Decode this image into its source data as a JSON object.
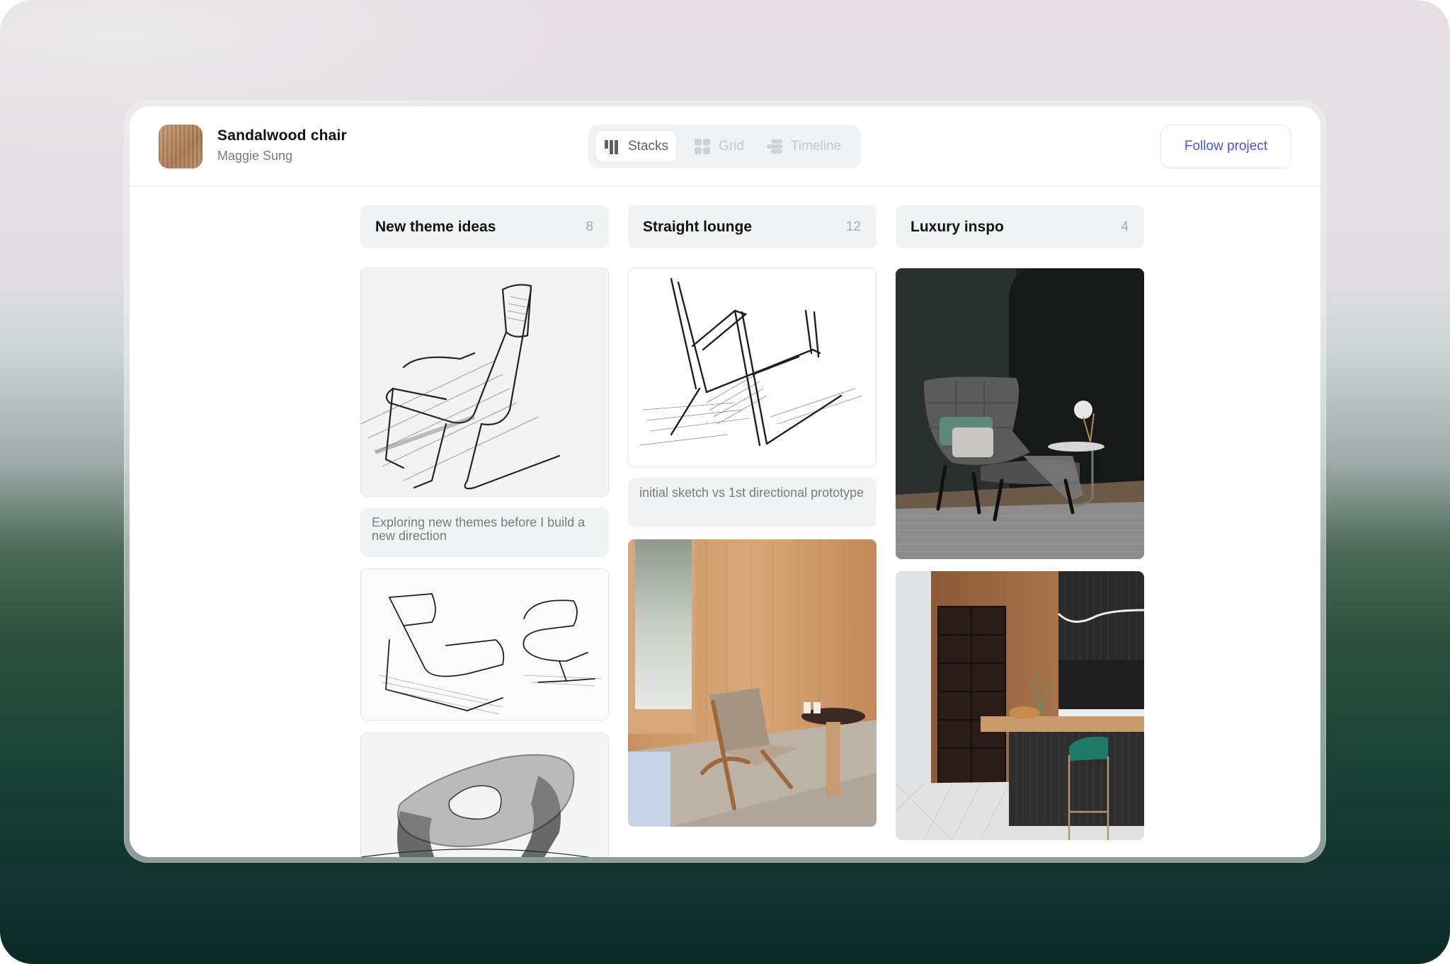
{
  "project": {
    "title": "Sandalwood chair",
    "owner": "Maggie Sung",
    "thumbnail": "wood-texture-thumbnail"
  },
  "view_toggle": {
    "options": [
      {
        "label": "Stacks",
        "icon": "stacks-icon",
        "active": true
      },
      {
        "label": "Grid",
        "icon": "grid-icon",
        "active": false
      },
      {
        "label": "Timeline",
        "icon": "timeline-icon",
        "active": false
      }
    ]
  },
  "actions": {
    "follow_label": "Follow project",
    "accent": "#4a55e6"
  },
  "columns": [
    {
      "title": "New theme ideas",
      "count": "8",
      "items": [
        {
          "type": "image",
          "description": "pencil sketch of tall reclining lounge chair with headrest"
        },
        {
          "type": "caption",
          "text": "Exploring new themes before I build a new direction"
        },
        {
          "type": "image",
          "description": "pencil sketch of cantilever lounger and swivel lounge chair"
        },
        {
          "type": "image",
          "description": "pencil sketch of sculptural bowl chair"
        }
      ]
    },
    {
      "title": "Straight lounge",
      "count": "12",
      "items": [
        {
          "type": "image",
          "description": "rough ink sketch of angular wooden lounge chair"
        },
        {
          "type": "caption",
          "text": "initial sketch vs 1st directional prototype"
        },
        {
          "type": "image",
          "description": "photo of woven folding chair against wood-paneled wall"
        }
      ]
    },
    {
      "title": "Luxury inspo",
      "count": "4",
      "items": [
        {
          "type": "image",
          "description": "photo of grey quilted wingback chair with ottoman in dark room"
        },
        {
          "type": "image",
          "description": "photo of wood and black kitchen with green velvet bar stool"
        }
      ]
    }
  ]
}
